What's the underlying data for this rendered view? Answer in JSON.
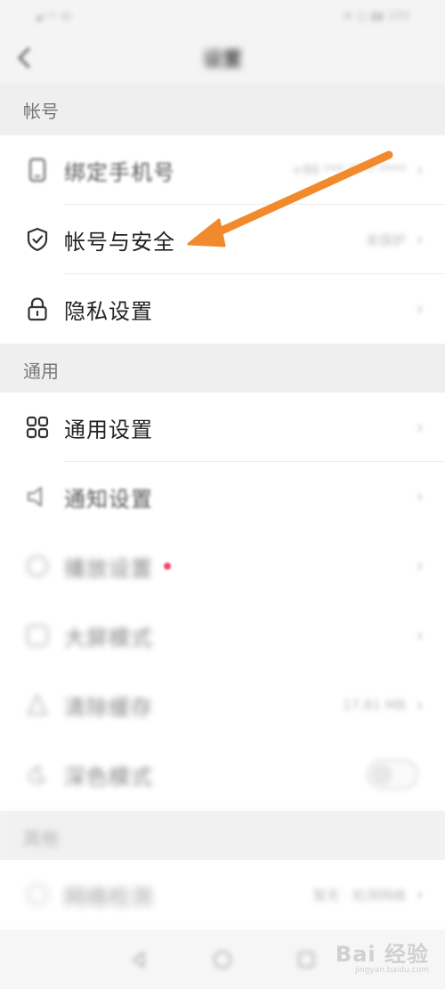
{
  "status_bar": {
    "left": "▪ᴸᵀᴱ 中",
    "right": "⊛ ◫ ▮▮ 100"
  },
  "nav": {
    "title": "设置"
  },
  "sections": {
    "account": "帐号",
    "general": "通用",
    "other": "其他"
  },
  "rows": {
    "bind_phone": {
      "label": "绑定手机号",
      "value": "+86 *** **** ****"
    },
    "account_security": {
      "label": "帐号与安全",
      "value": "未保护"
    },
    "privacy": {
      "label": "隐私设置"
    },
    "general_settings": {
      "label": "通用设置"
    },
    "notify_settings": {
      "label": "通知设置"
    },
    "row6": {
      "label": "播放设置"
    },
    "row7": {
      "label": "大屏模式"
    },
    "row8": {
      "label": "清除缓存",
      "value": "17.81 MB"
    },
    "row9": {
      "label": "深色模式"
    },
    "row10": {
      "label": "网络检测",
      "value": "暂无 · 检测网络"
    }
  },
  "watermark": {
    "main": "Bai 经验",
    "sub": "jingyan.baidu.com"
  },
  "colors": {
    "arrow": "#f08a2c",
    "background": "#f4f4f4",
    "card": "#ffffff"
  }
}
